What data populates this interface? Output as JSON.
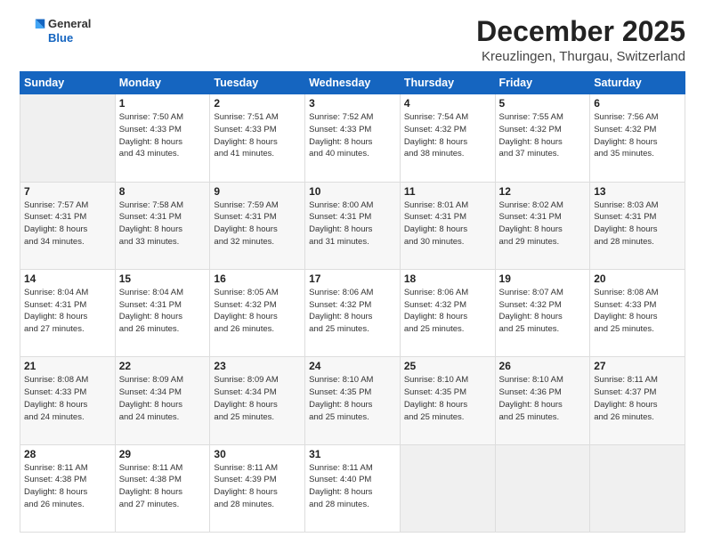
{
  "header": {
    "logo_general": "General",
    "logo_blue": "Blue",
    "title": "December 2025",
    "subtitle": "Kreuzlingen, Thurgau, Switzerland"
  },
  "calendar": {
    "days_of_week": [
      "Sunday",
      "Monday",
      "Tuesday",
      "Wednesday",
      "Thursday",
      "Friday",
      "Saturday"
    ],
    "weeks": [
      [
        {
          "day": "",
          "info": ""
        },
        {
          "day": "1",
          "info": "Sunrise: 7:50 AM\nSunset: 4:33 PM\nDaylight: 8 hours\nand 43 minutes."
        },
        {
          "day": "2",
          "info": "Sunrise: 7:51 AM\nSunset: 4:33 PM\nDaylight: 8 hours\nand 41 minutes."
        },
        {
          "day": "3",
          "info": "Sunrise: 7:52 AM\nSunset: 4:33 PM\nDaylight: 8 hours\nand 40 minutes."
        },
        {
          "day": "4",
          "info": "Sunrise: 7:54 AM\nSunset: 4:32 PM\nDaylight: 8 hours\nand 38 minutes."
        },
        {
          "day": "5",
          "info": "Sunrise: 7:55 AM\nSunset: 4:32 PM\nDaylight: 8 hours\nand 37 minutes."
        },
        {
          "day": "6",
          "info": "Sunrise: 7:56 AM\nSunset: 4:32 PM\nDaylight: 8 hours\nand 35 minutes."
        }
      ],
      [
        {
          "day": "7",
          "info": "Sunrise: 7:57 AM\nSunset: 4:31 PM\nDaylight: 8 hours\nand 34 minutes."
        },
        {
          "day": "8",
          "info": "Sunrise: 7:58 AM\nSunset: 4:31 PM\nDaylight: 8 hours\nand 33 minutes."
        },
        {
          "day": "9",
          "info": "Sunrise: 7:59 AM\nSunset: 4:31 PM\nDaylight: 8 hours\nand 32 minutes."
        },
        {
          "day": "10",
          "info": "Sunrise: 8:00 AM\nSunset: 4:31 PM\nDaylight: 8 hours\nand 31 minutes."
        },
        {
          "day": "11",
          "info": "Sunrise: 8:01 AM\nSunset: 4:31 PM\nDaylight: 8 hours\nand 30 minutes."
        },
        {
          "day": "12",
          "info": "Sunrise: 8:02 AM\nSunset: 4:31 PM\nDaylight: 8 hours\nand 29 minutes."
        },
        {
          "day": "13",
          "info": "Sunrise: 8:03 AM\nSunset: 4:31 PM\nDaylight: 8 hours\nand 28 minutes."
        }
      ],
      [
        {
          "day": "14",
          "info": "Sunrise: 8:04 AM\nSunset: 4:31 PM\nDaylight: 8 hours\nand 27 minutes."
        },
        {
          "day": "15",
          "info": "Sunrise: 8:04 AM\nSunset: 4:31 PM\nDaylight: 8 hours\nand 26 minutes."
        },
        {
          "day": "16",
          "info": "Sunrise: 8:05 AM\nSunset: 4:32 PM\nDaylight: 8 hours\nand 26 minutes."
        },
        {
          "day": "17",
          "info": "Sunrise: 8:06 AM\nSunset: 4:32 PM\nDaylight: 8 hours\nand 25 minutes."
        },
        {
          "day": "18",
          "info": "Sunrise: 8:06 AM\nSunset: 4:32 PM\nDaylight: 8 hours\nand 25 minutes."
        },
        {
          "day": "19",
          "info": "Sunrise: 8:07 AM\nSunset: 4:32 PM\nDaylight: 8 hours\nand 25 minutes."
        },
        {
          "day": "20",
          "info": "Sunrise: 8:08 AM\nSunset: 4:33 PM\nDaylight: 8 hours\nand 25 minutes."
        }
      ],
      [
        {
          "day": "21",
          "info": "Sunrise: 8:08 AM\nSunset: 4:33 PM\nDaylight: 8 hours\nand 24 minutes."
        },
        {
          "day": "22",
          "info": "Sunrise: 8:09 AM\nSunset: 4:34 PM\nDaylight: 8 hours\nand 24 minutes."
        },
        {
          "day": "23",
          "info": "Sunrise: 8:09 AM\nSunset: 4:34 PM\nDaylight: 8 hours\nand 25 minutes."
        },
        {
          "day": "24",
          "info": "Sunrise: 8:10 AM\nSunset: 4:35 PM\nDaylight: 8 hours\nand 25 minutes."
        },
        {
          "day": "25",
          "info": "Sunrise: 8:10 AM\nSunset: 4:35 PM\nDaylight: 8 hours\nand 25 minutes."
        },
        {
          "day": "26",
          "info": "Sunrise: 8:10 AM\nSunset: 4:36 PM\nDaylight: 8 hours\nand 25 minutes."
        },
        {
          "day": "27",
          "info": "Sunrise: 8:11 AM\nSunset: 4:37 PM\nDaylight: 8 hours\nand 26 minutes."
        }
      ],
      [
        {
          "day": "28",
          "info": "Sunrise: 8:11 AM\nSunset: 4:38 PM\nDaylight: 8 hours\nand 26 minutes."
        },
        {
          "day": "29",
          "info": "Sunrise: 8:11 AM\nSunset: 4:38 PM\nDaylight: 8 hours\nand 27 minutes."
        },
        {
          "day": "30",
          "info": "Sunrise: 8:11 AM\nSunset: 4:39 PM\nDaylight: 8 hours\nand 28 minutes."
        },
        {
          "day": "31",
          "info": "Sunrise: 8:11 AM\nSunset: 4:40 PM\nDaylight: 8 hours\nand 28 minutes."
        },
        {
          "day": "",
          "info": ""
        },
        {
          "day": "",
          "info": ""
        },
        {
          "day": "",
          "info": ""
        }
      ]
    ]
  }
}
